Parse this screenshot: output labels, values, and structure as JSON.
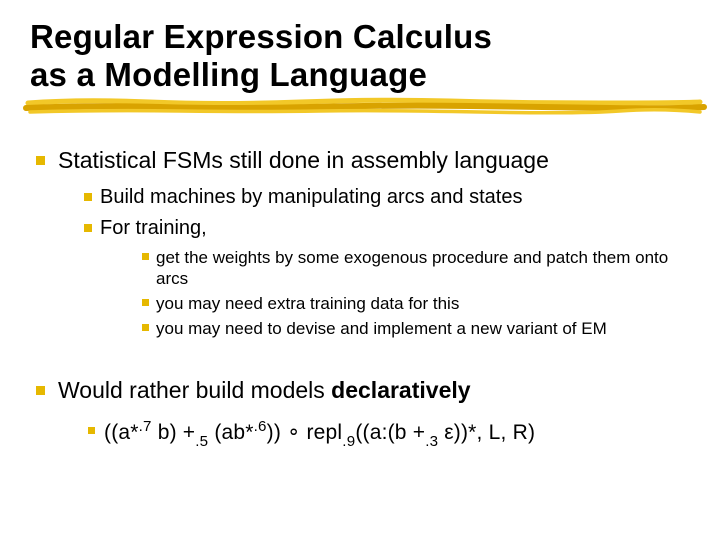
{
  "title_line1": "Regular Expression Calculus",
  "title_line2": "as a Modelling Language",
  "section1": {
    "heading": "Statistical FSMs still done in assembly language",
    "items": [
      "Build machines by manipulating arcs and states",
      "For training,"
    ],
    "subitems": [
      "get the weights by some exogenous procedure and patch them onto arcs",
      "you may need extra training data for this",
      "you may need to devise and implement a new variant of EM"
    ]
  },
  "section2": {
    "heading_pre": "Would rather build models ",
    "heading_bold": "declaratively",
    "formula": {
      "p1": "((a*",
      "sup1": ".7",
      "p2": " b)  +",
      "sub1": ".5",
      "p3": "  (ab*",
      "sup2": ".6",
      "p4": ")) ",
      "ring": "∘",
      "p5": " repl",
      "sub2": ".9",
      "p6": "((a:(b +",
      "sub3": ".3",
      "p7": " ε))*, L, R)"
    }
  }
}
